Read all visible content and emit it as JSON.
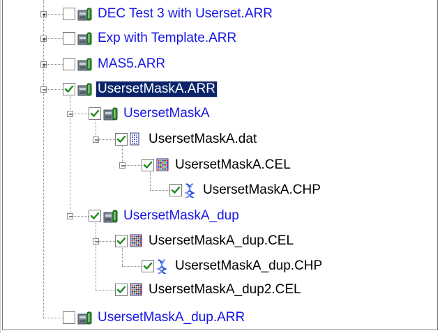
{
  "tree": {
    "nodes": [
      {
        "label": "DEC Test 3 with Userset.ARR",
        "checked": false,
        "expanded": false,
        "icon": "experiment-file-icon"
      },
      {
        "label": "Exp with Template.ARR",
        "checked": false,
        "expanded": false,
        "icon": "experiment-file-icon"
      },
      {
        "label": "MAS5.ARR",
        "checked": false,
        "expanded": false,
        "icon": "experiment-file-icon"
      },
      {
        "label": "UsersetMaskA.ARR",
        "checked": true,
        "expanded": true,
        "selected": true,
        "icon": "experiment-file-icon"
      },
      {
        "label": "UsersetMaskA",
        "checked": true,
        "expanded": true,
        "icon": "experiment-icon"
      },
      {
        "label": "UsersetMaskA.dat",
        "checked": true,
        "expanded": true,
        "icon": "dat-file-icon"
      },
      {
        "label": "UsersetMaskA.CEL",
        "checked": true,
        "expanded": true,
        "icon": "cel-file-icon"
      },
      {
        "label": "UsersetMaskA.CHP",
        "checked": true,
        "icon": "chp-file-icon"
      },
      {
        "label": "UsersetMaskA_dup",
        "checked": true,
        "expanded": true,
        "icon": "experiment-icon"
      },
      {
        "label": "UsersetMaskA_dup.CEL",
        "checked": true,
        "expanded": true,
        "icon": "cel-file-icon"
      },
      {
        "label": "UsersetMaskA_dup.CHP",
        "checked": true,
        "icon": "chp-file-icon"
      },
      {
        "label": "UsersetMaskA_dup2.CEL",
        "checked": true,
        "icon": "cel-file-icon"
      },
      {
        "label": "UsersetMaskA_dup.ARR",
        "checked": false,
        "icon": "experiment-file-icon"
      }
    ]
  },
  "colors": {
    "link_blue": "#1414e6",
    "selection_bg": "#0a246a",
    "check_green": "#1c8a1c",
    "tree_lines": "#8a8a8a"
  }
}
